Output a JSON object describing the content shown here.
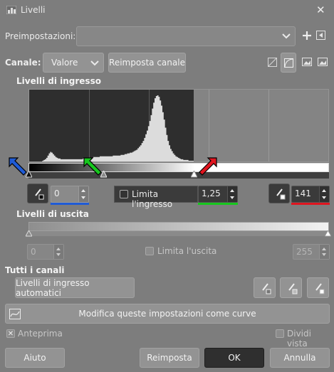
{
  "window": {
    "title": "Livelli",
    "close_glyph": "✕"
  },
  "presets": {
    "label": "Preimpostazioni:",
    "value": ""
  },
  "channel": {
    "label": "Canale:",
    "value": "Valore",
    "reset_label": "Reimposta canale"
  },
  "input_levels": {
    "heading": "Livelli di ingresso",
    "black": "0",
    "gamma": "1,25",
    "white": "141",
    "clamp_label": "Limita l'ingresso",
    "black_fraction": 0.0,
    "white_fraction": 0.553,
    "gamma_fraction": 0.25
  },
  "output_levels": {
    "heading": "Livelli di uscita",
    "low": "0",
    "high": "255",
    "clamp_label": "Limita l'uscita"
  },
  "all_channels": {
    "heading": "Tutti i canali",
    "auto_label": "Livelli di ingresso automatici"
  },
  "curves_label": "Modifica queste impostazioni come curve",
  "preview": {
    "label": "Anteprima",
    "checked": true
  },
  "split_view": {
    "label": "Dividi vista",
    "checked": false
  },
  "buttons": {
    "help": "Aiuto",
    "reset": "Reimposta",
    "ok": "OK",
    "cancel": "Annulla"
  },
  "colors": {
    "accent_blue": "#1f5bd6",
    "accent_green": "#17c71e",
    "accent_red": "#e0151f",
    "ok_bg": "#2f2f2f"
  },
  "histogram": [
    0,
    0,
    0,
    0,
    0,
    0,
    0,
    0,
    0,
    0,
    1,
    2,
    3,
    5,
    8,
    11,
    13,
    12,
    10,
    8,
    6,
    5,
    4,
    4,
    3,
    3,
    3,
    3,
    3,
    3,
    3,
    3,
    3,
    3,
    3,
    3,
    3,
    3,
    3,
    3,
    3,
    4,
    4,
    4,
    4,
    5,
    5,
    5,
    5,
    6,
    6,
    6,
    6,
    6,
    7,
    7,
    7,
    7,
    7,
    7,
    7,
    7,
    7,
    7,
    8,
    8,
    8,
    8,
    8,
    8,
    9,
    9,
    9,
    10,
    10,
    11,
    11,
    12,
    12,
    13,
    14,
    15,
    16,
    18,
    20,
    22,
    25,
    28,
    32,
    37,
    42,
    48,
    55,
    63,
    72,
    80,
    86,
    89,
    90,
    88,
    83,
    76,
    67,
    57,
    46,
    36,
    28,
    22,
    17,
    14,
    11,
    9,
    7,
    6,
    5,
    4,
    3,
    3,
    2,
    2,
    2,
    2,
    1,
    1,
    1,
    1
  ]
}
